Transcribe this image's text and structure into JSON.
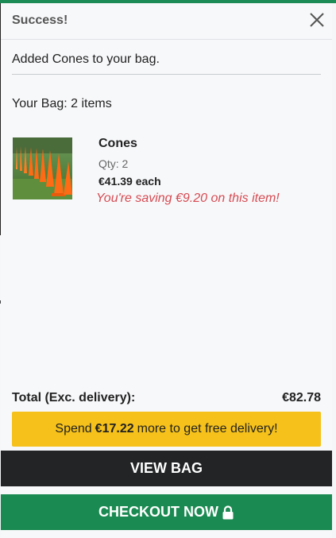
{
  "modal": {
    "title": "Success!",
    "close_icon": "close-icon",
    "message": "Added Cones to your bag.",
    "bag_summary": "Your Bag: 2 items"
  },
  "item": {
    "name": "Cones",
    "qty": "Qty: 2",
    "price": "€41.39 each",
    "saving": "You're saving €9.20 on this item!",
    "image_icon": "orange-cones-photo"
  },
  "totals": {
    "label": "Total (Exc. delivery):",
    "value": "€82.78"
  },
  "delivery": {
    "prefix": "Spend",
    "amount": "€17.22",
    "suffix": "more to get free delivery!"
  },
  "buttons": {
    "view_bag": "VIEW BAG",
    "checkout": "CHECKOUT NOW",
    "checkout_icon": "lock-icon"
  },
  "colors": {
    "accent_green": "#1b8a52",
    "banner_yellow": "#f5c11a",
    "dark_button": "#222426",
    "saving_red": "#d64b52"
  }
}
